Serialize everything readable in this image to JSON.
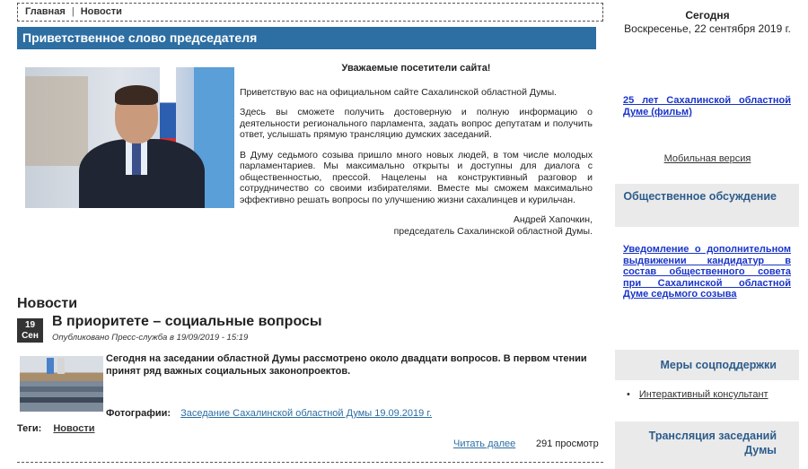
{
  "breadcrumb": {
    "home": "Главная",
    "separator": "|",
    "current": "Новости"
  },
  "welcome": {
    "bar_title": "Приветственное слово председателя",
    "greeting": "Уважаемые посетители сайта!",
    "paragraphs": [
      "Приветствую вас на официальном сайте Сахалинской областной Думы.",
      "Здесь вы сможете получить достоверную и полную информацию о деятельности регионального парламента, задать вопрос депутатам и получить ответ, услышать прямую трансляцию думских заседаний.",
      "В Думу седьмого созыва пришло много новых людей, в том числе молодых парламентариев. Мы максимально открыты и доступны для диалога с общественностью, прессой. Нацелены на конструктивный разговор и сотрудничество со своими избирателями. Вместе мы сможем максимально эффективно решать вопросы по улучшению жизни сахалинцев и курильчан."
    ],
    "signature_name": "Андрей Хапочкин,",
    "signature_role": "председатель Сахалинской областной Думы."
  },
  "news": {
    "section_title": "Новости",
    "date_day": "19",
    "date_month": "Сен",
    "article_title": "В приоритете – социальные вопросы",
    "published": "Опубликовано Пресс-служба в 19/09/2019 - 15:19",
    "lead": "Сегодня на заседании областной Думы рассмотрено около двадцати вопросов. В первом чтении принят ряд важных социальных законопроектов.",
    "photos_label": "Фотографии:",
    "photos_link": "Заседание Сахалинской областной Думы 19.09.2019 г.",
    "tags_label": "Теги:",
    "tag": "Новости",
    "read_more": "Читать далее",
    "views": "291 просмотр"
  },
  "sidebar": {
    "today_label": "Сегодня",
    "today_date": "Воскресенье, 22 сентября 2019 г.",
    "film_link": "25 лет Сахалинской областной Думе (фильм)",
    "mobile_link": "Мобильная версия",
    "discussion_title": "Общественное обсуждение",
    "discussion_link": "Уведомление о дополнительном выдвижении кандидатур в состав общественного совета при Сахалинской областной Думе седьмого созыва",
    "support_title": "Меры соцподдержки",
    "consultant_link": "Интерактивный консультант",
    "broadcast_title": "Трансляция заседаний Думы"
  },
  "colors": {
    "accent": "#2d6ea3",
    "link": "#1a35c8",
    "side_header_bg": "#eaeaea"
  }
}
